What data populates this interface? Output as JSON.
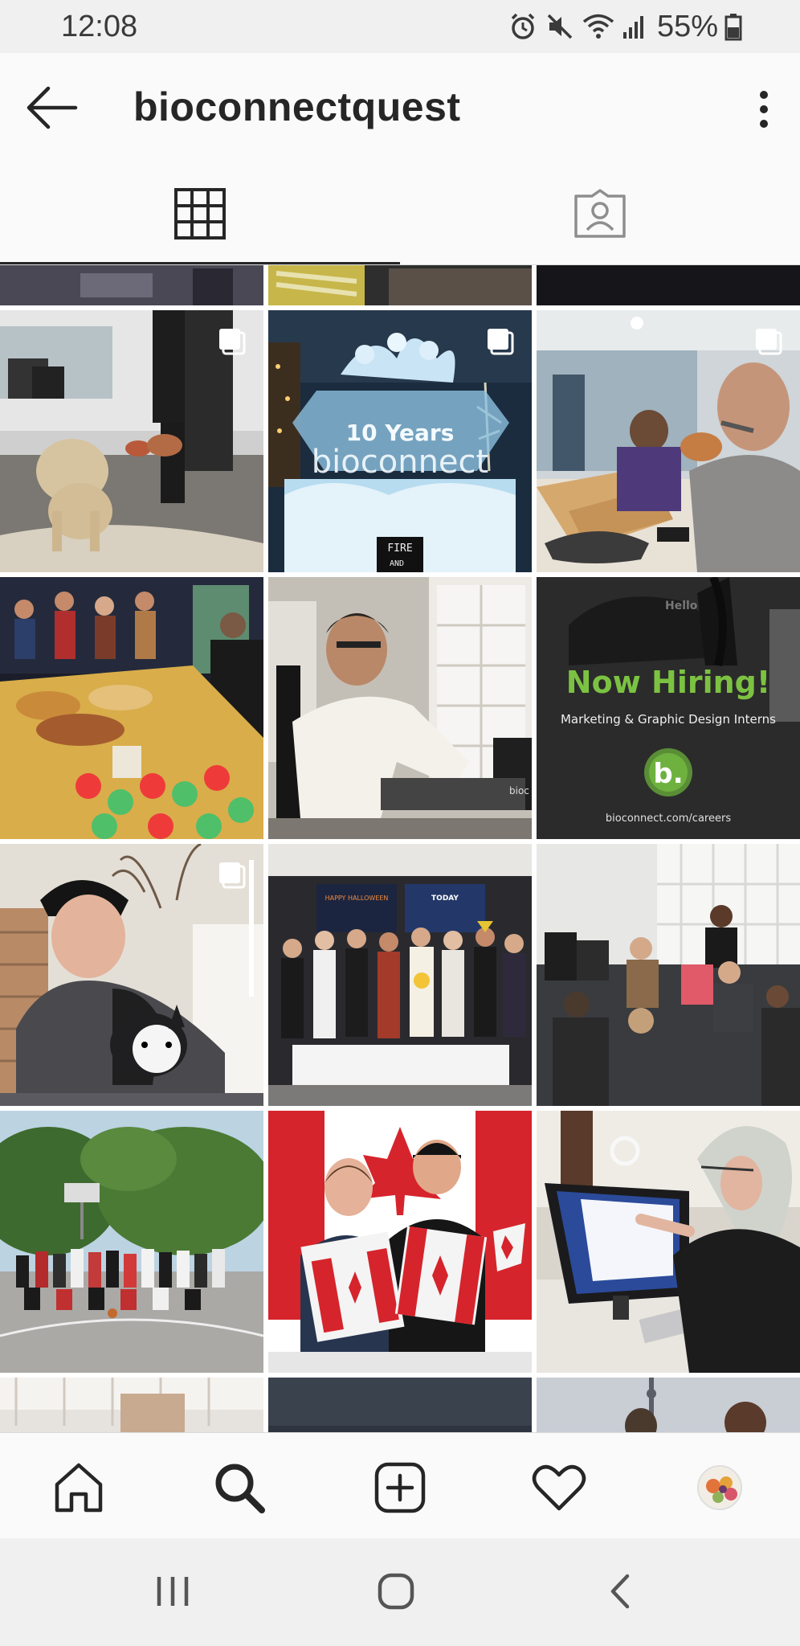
{
  "status_bar": {
    "time": "12:08",
    "battery": "55%",
    "icons": [
      "alarm-icon",
      "mute-icon",
      "wifi-icon",
      "signal-icon",
      "battery-icon"
    ]
  },
  "header": {
    "username": "bioconnectquest",
    "back_icon": "arrow-left-icon",
    "more_icon": "vertical-ellipsis-icon"
  },
  "tabs": [
    {
      "name": "posts-grid",
      "icon": "grid-icon",
      "selected": true
    },
    {
      "name": "tagged",
      "icon": "tagged-person-icon",
      "selected": false
    }
  ],
  "posts": {
    "ice_sculpture_text_1": "10 Years",
    "ice_sculpture_text_2": "bioconnect",
    "ice_sign": "FIRE",
    "ice_sign_2": "AND",
    "hiring_headline": "Now Hiring!",
    "hiring_subtitle": "Marketing & Graphic Design Interns",
    "hiring_logo": "b.",
    "hiring_url": "bioconnect.com/careers",
    "hiring_bag_text": "Hello",
    "laptop_text": "bioc",
    "halloween_screen_left": "HAPPY HALLOWEEN",
    "halloween_screen_right": "TODAY"
  },
  "bottom_nav": {
    "items": [
      "home-icon",
      "search-icon",
      "add-post-icon",
      "activity-heart-icon",
      "profile-avatar"
    ]
  },
  "colors": {
    "accent": "#262626",
    "hiring_green": "#7cc242",
    "status_bg": "#f0f0f0"
  }
}
